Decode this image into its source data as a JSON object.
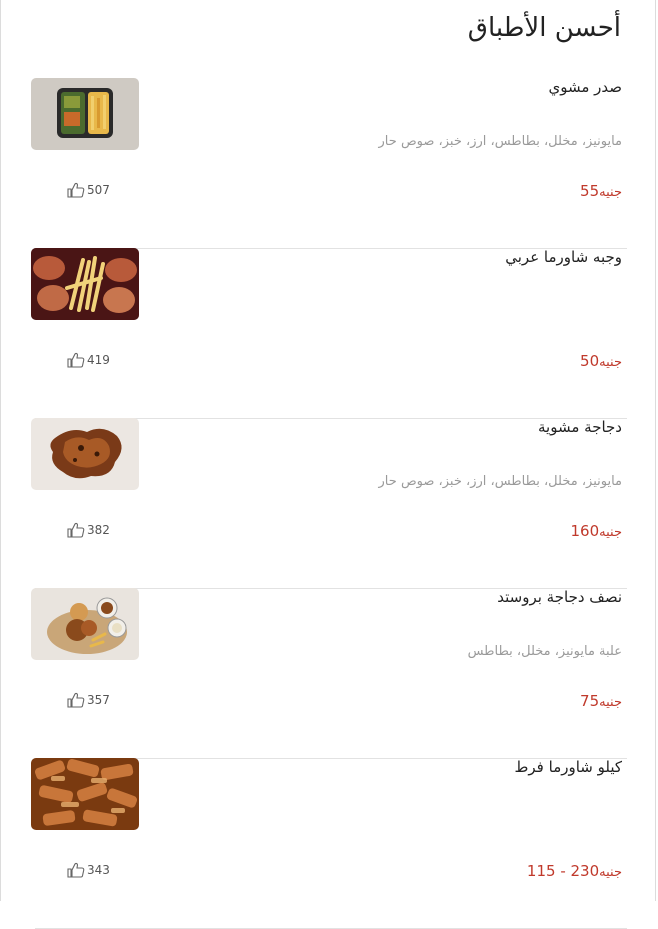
{
  "page": {
    "title": "أحسن الأطباق"
  },
  "dishes": [
    {
      "name": "صدر مشوي",
      "description": "مايونيز، مخلل، بطاطس، ارز، خبز، صوص حار",
      "price": "55",
      "currency": "جنيه",
      "likes": "507",
      "image_icon": "grilled-chicken-box-photo"
    },
    {
      "name": "وجبه شاورما عربي",
      "description": "",
      "price": "50",
      "currency": "جنيه",
      "likes": "419",
      "image_icon": "shawarma-meal-photo"
    },
    {
      "name": "دجاجة مشوية",
      "description": "مايونيز، مخلل، بطاطس، ارز، خبز، صوص حار",
      "price": "160",
      "currency": "جنيه",
      "likes": "382",
      "image_icon": "grilled-chicken-photo"
    },
    {
      "name": "نصف دجاجة بروستد",
      "description": "علبة مايونيز، مخلل، بطاطس",
      "price": "75",
      "currency": "جنيه",
      "likes": "357",
      "image_icon": "broasted-chicken-photo"
    },
    {
      "name": "كيلو شاورما فرط",
      "description": "",
      "price": "115 - 230",
      "currency": "جنيه",
      "likes": "343",
      "image_icon": "shawarma-kilo-photo"
    }
  ],
  "colors": {
    "price": "#c0392b",
    "description": "#9a9a9a",
    "divider": "#e2e2e2"
  }
}
